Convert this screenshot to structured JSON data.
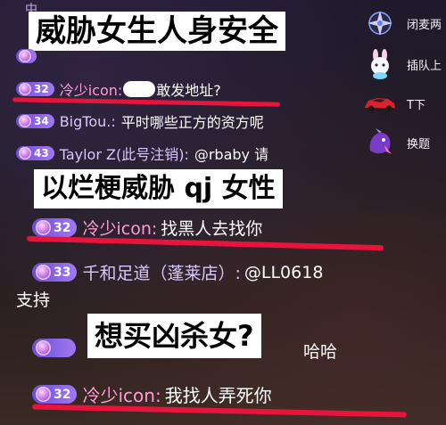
{
  "captions": {
    "c1": "威胁女生人身安全",
    "c2": "以烂梗威胁 qj 女性",
    "c3": "想买凶杀女?"
  },
  "chat": [
    {
      "level": "",
      "name": "中…",
      "message": "",
      "partial": true
    },
    {
      "level": "32",
      "name": "冷少icon:",
      "message": "敢发地址?"
    },
    {
      "level": "34",
      "name": "BigTou.:",
      "message": "平时哪些正方的资方呢"
    },
    {
      "level": "43",
      "name": "Taylor Z(此号注销):",
      "message": "@rbaby 请"
    },
    {
      "level": "32",
      "name": "冷少icon:",
      "message": "找黑人去找你"
    },
    {
      "level": "33",
      "name": "千和足道（蓬莱店）:",
      "message": "@LL0618"
    },
    {
      "level": "",
      "name": "",
      "message": "支持"
    },
    {
      "level": "",
      "name": "",
      "message": "哈哈"
    },
    {
      "level": "32",
      "name": "冷少icon:",
      "message": "我找人弄死你"
    }
  ],
  "sidebar": {
    "items": [
      {
        "label": "闭麦两",
        "icon": "star-compass-icon"
      },
      {
        "label": "插队上",
        "icon": "bunny-mascot-icon"
      },
      {
        "label": "T下",
        "icon": "race-car-icon"
      },
      {
        "label": "换题",
        "icon": "purple-dragon-icon"
      }
    ]
  },
  "colors": {
    "badge": "#7b5ce0",
    "underline": "#e8143c",
    "caption_bg": "#ffffff"
  }
}
